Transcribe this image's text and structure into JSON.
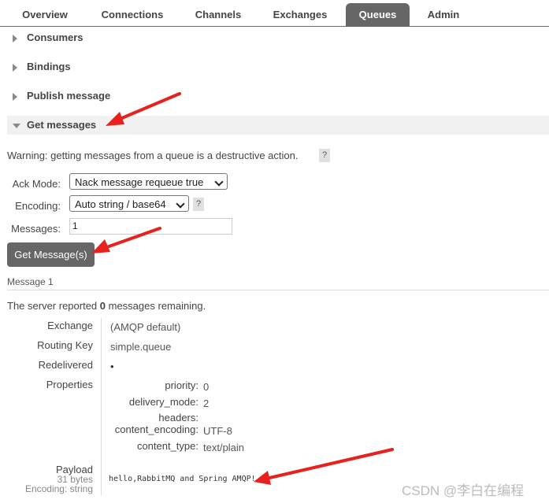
{
  "tabs": [
    {
      "label": "Overview"
    },
    {
      "label": "Connections"
    },
    {
      "label": "Channels"
    },
    {
      "label": "Exchanges"
    },
    {
      "label": "Queues",
      "active": true
    },
    {
      "label": "Admin"
    }
  ],
  "sections": {
    "consumers": "Consumers",
    "bindings": "Bindings",
    "publish": "Publish message",
    "get": "Get messages"
  },
  "warning": "Warning: getting messages from a queue is a destructive action.",
  "help_glyph": "?",
  "form": {
    "ack_mode_label": "Ack Mode:",
    "ack_mode_value": "Nack message requeue true",
    "encoding_label": "Encoding:",
    "encoding_value": "Auto string / base64",
    "messages_label": "Messages:",
    "messages_value": "1",
    "get_button": "Get Message(s)"
  },
  "result": {
    "heading": "Message 1",
    "server_text_prefix": "The server reported ",
    "server_count": "0",
    "server_text_suffix": " messages remaining.",
    "exchange_label": "Exchange",
    "exchange_value": "(AMQP default)",
    "routing_key_label": "Routing Key",
    "routing_key_value": "simple.queue",
    "redelivered_label": "Redelivered",
    "redelivered_value": "•",
    "properties_label": "Properties",
    "properties": [
      {
        "key": "priority:",
        "value": "0"
      },
      {
        "key": "delivery_mode:",
        "value": "2"
      },
      {
        "key": "headers:",
        "value": ""
      },
      {
        "key": "content_encoding:",
        "value": "UTF-8"
      },
      {
        "key": "content_type:",
        "value": "text/plain"
      }
    ],
    "payload_label": "Payload",
    "payload_size": "31 bytes",
    "payload_encoding": "Encoding: string",
    "payload_value": "hello,RabbitMQ and Spring AMQP!"
  },
  "watermark": "CSDN @李白在编程",
  "colors": {
    "tab_active": "#666666",
    "arrow": "#e8201e",
    "section_bg": "#f1f1f1"
  }
}
